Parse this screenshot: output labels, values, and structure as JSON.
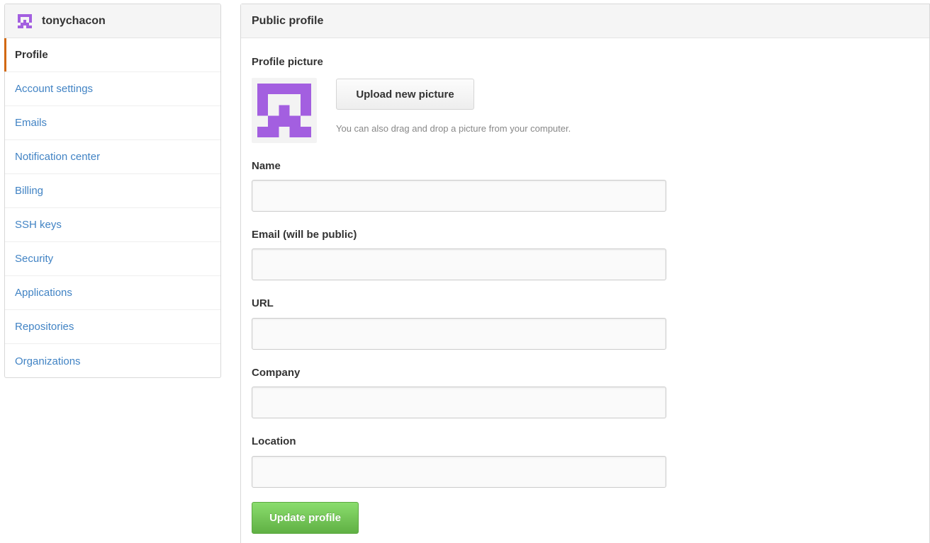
{
  "sidebar": {
    "username": "tonychacon",
    "items": [
      {
        "label": "Profile",
        "selected": true
      },
      {
        "label": "Account settings",
        "selected": false
      },
      {
        "label": "Emails",
        "selected": false
      },
      {
        "label": "Notification center",
        "selected": false
      },
      {
        "label": "Billing",
        "selected": false
      },
      {
        "label": "SSH keys",
        "selected": false
      },
      {
        "label": "Security",
        "selected": false
      },
      {
        "label": "Applications",
        "selected": false
      },
      {
        "label": "Repositories",
        "selected": false
      },
      {
        "label": "Organizations",
        "selected": false
      }
    ]
  },
  "main": {
    "title": "Public profile",
    "picture": {
      "label": "Profile picture",
      "upload_label": "Upload new picture",
      "hint": "You can also drag and drop a picture from your computer."
    },
    "fields": {
      "name": {
        "label": "Name",
        "value": ""
      },
      "email": {
        "label": "Email (will be public)",
        "value": ""
      },
      "url": {
        "label": "URL",
        "value": ""
      },
      "company": {
        "label": "Company",
        "value": ""
      },
      "location": {
        "label": "Location",
        "value": ""
      }
    },
    "submit_label": "Update profile"
  },
  "colors": {
    "link": "#4183c4",
    "selected_accent": "#d26911",
    "avatar": "#a35fe0",
    "primary_button": "#6cc644"
  },
  "icons": {
    "avatar": "identicon-avatar"
  }
}
